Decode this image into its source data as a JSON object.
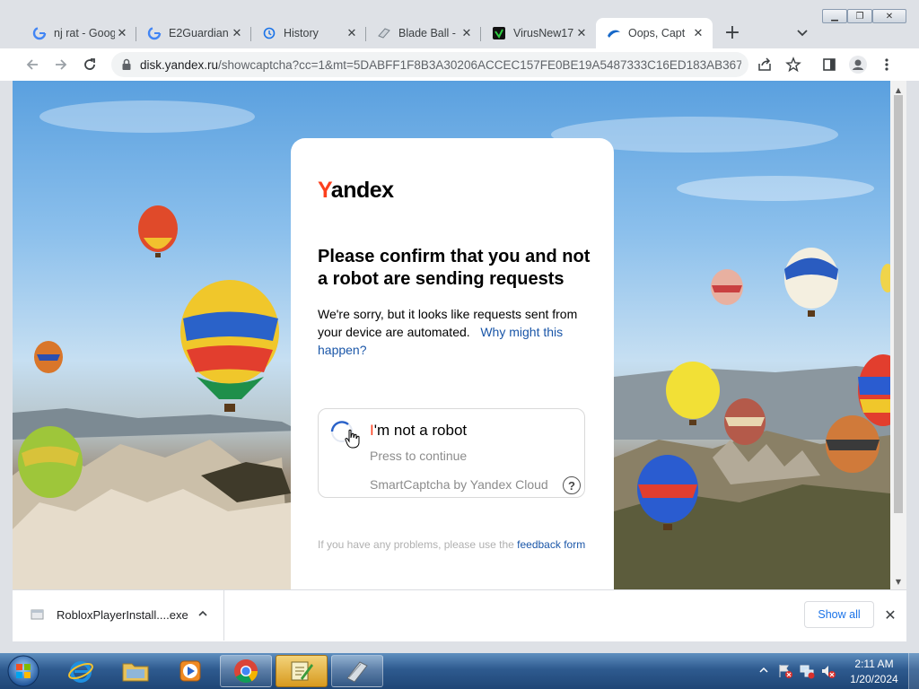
{
  "browser": {
    "tabs": [
      {
        "title": "nj rat - Goog",
        "icon": "google-icon",
        "active": false
      },
      {
        "title": "E2Guardian",
        "icon": "google-icon",
        "active": false
      },
      {
        "title": "History",
        "icon": "history-icon",
        "active": false
      },
      {
        "title": "Blade Ball -",
        "icon": "page-icon",
        "active": false
      },
      {
        "title": "VirusNew17",
        "icon": "virus-site-icon",
        "active": false
      },
      {
        "title": "Oops, Capt",
        "icon": "yandex-disk-icon",
        "active": true
      }
    ],
    "new_tab_symbol": "+",
    "url": {
      "host": "disk.yandex.ru",
      "path": "/showcaptcha?cc=1&mt=5DABFF1F8B3A30206ACCEC157FE0BE19A5487333C16ED183AB367..."
    }
  },
  "page": {
    "logo_first_letter": "Y",
    "logo_rest": "andex",
    "heading": "Please confirm that you and not a robot are sending requests",
    "description": "We're sorry, but it looks like requests sent from your device are automated.",
    "why_link": "Why might this happen?",
    "captcha": {
      "title_first": "I",
      "title_rest": "'m not a robot",
      "subtitle": "Press to continue",
      "brand": "SmartCaptcha by Yandex Cloud",
      "help_symbol": "?"
    },
    "problems_text": "If you have any problems, please use the",
    "feedback_link": "feedback form"
  },
  "downloads": {
    "file_name": "RobloxPlayerInstall....exe",
    "show_all_label": "Show all"
  },
  "taskbar": {
    "apps": [
      "internet-explorer-icon",
      "file-explorer-icon",
      "media-player-icon",
      "chrome-icon",
      "notepad-app-icon",
      "generic-app-icon"
    ],
    "time": "2:11 AM",
    "date": "1/20/2024"
  },
  "colors": {
    "yandex_red": "#fc3f1d",
    "link_blue": "#1a56a8",
    "chrome_blue": "#1a73e8"
  }
}
